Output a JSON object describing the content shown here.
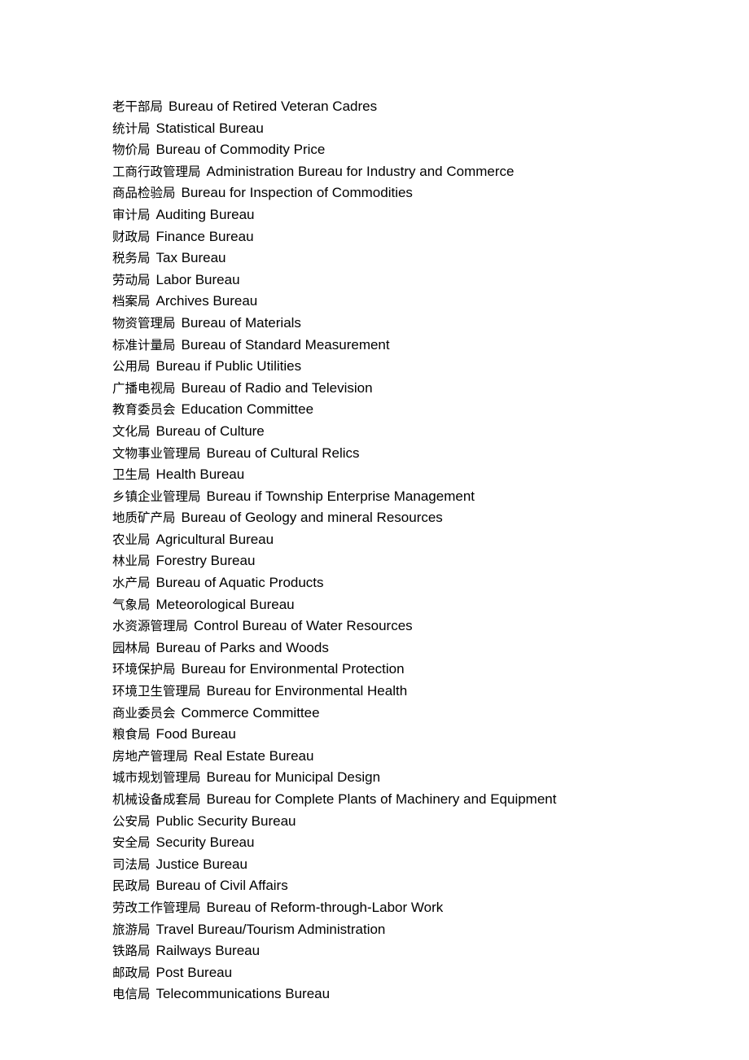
{
  "document": {
    "kind": "glossary",
    "page_background": "#ffffff",
    "text_color": "#000000",
    "entries": [
      {
        "cn": "老干部局",
        "en": "Bureau of Retired Veteran Cadres"
      },
      {
        "cn": "统计局",
        "en": "Statistical Bureau"
      },
      {
        "cn": "物价局",
        "en": "Bureau of Commodity Price"
      },
      {
        "cn": "工商行政管理局",
        "en": "Administration Bureau for Industry and Commerce"
      },
      {
        "cn": "商品检验局",
        "en": "Bureau for Inspection of Commodities"
      },
      {
        "cn": "审计局",
        "en": "Auditing Bureau"
      },
      {
        "cn": "财政局",
        "en": "Finance Bureau"
      },
      {
        "cn": "税务局",
        "en": "Tax Bureau"
      },
      {
        "cn": "劳动局",
        "en": "Labor Bureau"
      },
      {
        "cn": "档案局",
        "en": "Archives Bureau"
      },
      {
        "cn": "物资管理局",
        "en": "Bureau of Materials"
      },
      {
        "cn": "标准计量局",
        "en": "Bureau of Standard Measurement"
      },
      {
        "cn": "公用局",
        "en": "Bureau if Public Utilities"
      },
      {
        "cn": "广播电视局",
        "en": "Bureau of Radio and Television"
      },
      {
        "cn": "教育委员会",
        "en": "Education Committee"
      },
      {
        "cn": "文化局",
        "en": "Bureau of Culture"
      },
      {
        "cn": "文物事业管理局",
        "en": "Bureau of Cultural Relics"
      },
      {
        "cn": "卫生局",
        "en": "Health Bureau"
      },
      {
        "cn": "乡镇企业管理局",
        "en": "Bureau if Township Enterprise Management"
      },
      {
        "cn": "地质矿产局",
        "en": "Bureau of Geology and mineral Resources"
      },
      {
        "cn": "农业局",
        "en": "Agricultural Bureau"
      },
      {
        "cn": "林业局",
        "en": "Forestry Bureau"
      },
      {
        "cn": "水产局",
        "en": "Bureau of Aquatic Products"
      },
      {
        "cn": "气象局",
        "en": "Meteorological Bureau"
      },
      {
        "cn": "水资源管理局",
        "en": "Control Bureau of Water Resources"
      },
      {
        "cn": "园林局",
        "en": "Bureau of Parks and Woods"
      },
      {
        "cn": "环境保护局",
        "en": "Bureau for Environmental Protection"
      },
      {
        "cn": "环境卫生管理局",
        "en": "Bureau for Environmental Health"
      },
      {
        "cn": "商业委员会",
        "en": "Commerce Committee"
      },
      {
        "cn": "粮食局",
        "en": "Food Bureau"
      },
      {
        "cn": "房地产管理局",
        "en": "Real Estate Bureau"
      },
      {
        "cn": "城市规划管理局",
        "en": "Bureau for Municipal Design"
      },
      {
        "cn": "机械设备成套局",
        "en": "Bureau for Complete Plants of Machinery and Equipment"
      },
      {
        "cn": "公安局",
        "en": "Public Security Bureau"
      },
      {
        "cn": "安全局",
        "en": "Security Bureau"
      },
      {
        "cn": "司法局",
        "en": "Justice Bureau"
      },
      {
        "cn": "民政局",
        "en": "Bureau of Civil Affairs"
      },
      {
        "cn": "劳改工作管理局",
        "en": "Bureau of Reform-through-Labor Work"
      },
      {
        "cn": "旅游局",
        "en": "Travel Bureau/Tourism Administration"
      },
      {
        "cn": "铁路局",
        "en": "Railways Bureau"
      },
      {
        "cn": "邮政局",
        "en": "Post Bureau"
      },
      {
        "cn": "电信局",
        "en": "Telecommunications Bureau"
      }
    ]
  }
}
